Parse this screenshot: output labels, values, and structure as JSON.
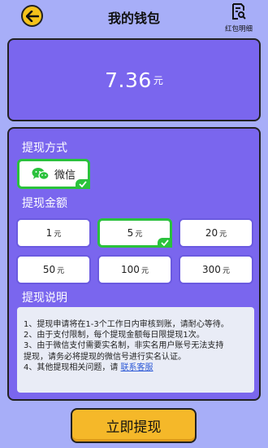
{
  "header": {
    "title": "我的钱包",
    "detail_label": "红包明细"
  },
  "balance": {
    "amount": "7.36",
    "unit": "元"
  },
  "method": {
    "title": "提现方式",
    "selected": {
      "label": "微信"
    }
  },
  "amounts": {
    "title": "提现金额",
    "unit": "元",
    "options": [
      "1",
      "5",
      "20",
      "50",
      "100",
      "300"
    ],
    "selected_value": "5"
  },
  "notes": {
    "title": "提现说明",
    "lines": [
      "1、提现申请将在1-3个工作日内审核到账，请耐心等待。",
      "2、由于支付限制，每个提现金额每日限提现1次。",
      "3、由于微信支付需要实名制，非实名用户账号无法支持",
      "提现，请务必将提现的微信号进行实名认证。",
      "4、其他提现相关问题，请 "
    ],
    "link": "联系客服"
  },
  "submit_label": "立即提现",
  "colors": {
    "primary": "#7a66ee",
    "selected": "#2ac23c",
    "button": "#f5b829",
    "background": "#a7aef8"
  }
}
